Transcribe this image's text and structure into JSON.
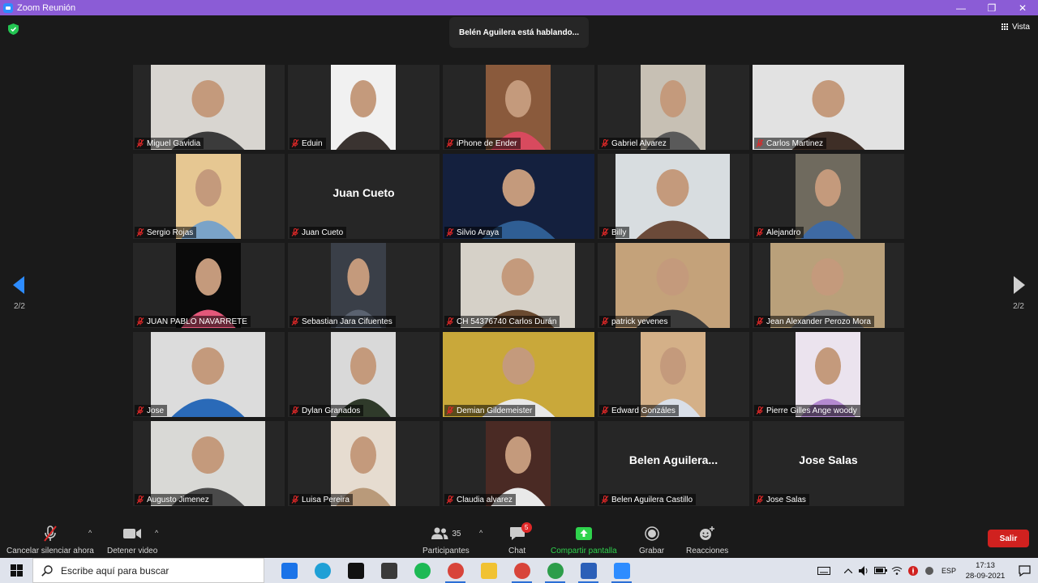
{
  "window": {
    "title": "Zoom Reunión",
    "minimize": "—",
    "maximize": "❐",
    "close": "✕"
  },
  "meeting": {
    "speaking_banner": "Belén Aguilera está hablando...",
    "view_label": "Vista",
    "page_left": "2/2",
    "page_right": "2/2"
  },
  "participants": [
    {
      "name": "Miguel Gavidia",
      "video": {
        "x": 22,
        "w": 141,
        "bg": "#d8d5d0",
        "fg": "#3b3b3b"
      }
    },
    {
      "name": "Eduin",
      "video": {
        "x": 53,
        "w": 80,
        "bg": "#f1f1f1",
        "fg": "#3a3330"
      }
    },
    {
      "name": "iPhone de Ender",
      "video": {
        "x": 53,
        "w": 80,
        "bg": "#8a5a3c",
        "fg": "#d84a5e"
      }
    },
    {
      "name": "Gabriel Alvarez",
      "video": {
        "x": 53,
        "w": 80,
        "bg": "#c7c0b4",
        "fg": "#5a5a5a"
      }
    },
    {
      "name": "Carlos Martinez",
      "video": {
        "x": 0,
        "w": 187,
        "bg": "#e2e2e2",
        "fg": "#3e2e26"
      }
    },
    {
      "name": "Sergio Rojas",
      "video": {
        "x": 53,
        "w": 80,
        "bg": "#e6c792",
        "fg": "#7aa3c8"
      }
    },
    {
      "name": "Juan Cueto",
      "name_display": "Juan Cueto"
    },
    {
      "name": "Silvio Araya",
      "video": {
        "x": 0,
        "w": 187,
        "bg": "#14203e",
        "fg": "#2f5e94"
      }
    },
    {
      "name": "Billy",
      "video": {
        "x": 22,
        "w": 141,
        "bg": "#d8dde0",
        "fg": "#6b4a39"
      }
    },
    {
      "name": "Alejandro",
      "video": {
        "x": 53,
        "w": 80,
        "bg": "#6f6a5e",
        "fg": "#3e6aa4"
      }
    },
    {
      "name": "JUAN PABLO  NAVARRETE",
      "video": {
        "x": 53,
        "w": 80,
        "bg": "#0a0a0a",
        "fg": "#e4587a"
      }
    },
    {
      "name": "Sebastian Jara Cifuentes",
      "video": {
        "x": 53,
        "w": 68,
        "bg": "#3a3f48",
        "fg": "#5a6270"
      }
    },
    {
      "name": "CH 54376740 Carlos Durán",
      "video": {
        "x": 22,
        "w": 141,
        "bg": "#d6d1c8",
        "fg": "#6a4a30"
      }
    },
    {
      "name": "patrick yevenes",
      "video": {
        "x": 22,
        "w": 141,
        "bg": "#c4a27a",
        "fg": "#3a3a3a"
      }
    },
    {
      "name": "Jean Alexander Perozo Mora",
      "video": {
        "x": 22,
        "w": 141,
        "bg": "#b9a07a",
        "fg": "#7a7a7a"
      }
    },
    {
      "name": "Jose",
      "video": {
        "x": 22,
        "w": 141,
        "bg": "#dcdcdc",
        "fg": "#2a6ab8"
      }
    },
    {
      "name": "Dylan Granados",
      "video": {
        "x": 53,
        "w": 80,
        "bg": "#d9d9d9",
        "fg": "#2f3a2a"
      }
    },
    {
      "name": "Demian Gildemeister",
      "video": {
        "x": 0,
        "w": 187,
        "bg": "#c9a83a",
        "fg": "#e8e8e8"
      }
    },
    {
      "name": "Edward Gonzáles",
      "video": {
        "x": 53,
        "w": 80,
        "bg": "#d4b088",
        "fg": "#d9dfe8"
      }
    },
    {
      "name": "Pierre Gilles Ange woody",
      "video": {
        "x": 53,
        "w": 80,
        "bg": "#ebe3ee",
        "fg": "#b48ad0"
      }
    },
    {
      "name": "Augusto Jimenez",
      "video": {
        "x": 22,
        "w": 141,
        "bg": "#d9d9d6",
        "fg": "#4a4a4a"
      }
    },
    {
      "name": "Luisa Pereira",
      "video": {
        "x": 53,
        "w": 80,
        "bg": "#e6dcd0",
        "fg": "#b99a7a"
      }
    },
    {
      "name": "Claudia alvarez",
      "video": {
        "x": 53,
        "w": 80,
        "bg": "#4a2a24",
        "fg": "#e9e9e9"
      }
    },
    {
      "name": "Belen Aguilera Castillo",
      "name_display": "Belen  Aguilera..."
    },
    {
      "name": "Jose Salas",
      "name_display": "Jose Salas"
    }
  ],
  "toolbar": {
    "mute_label": "Cancelar silenciar ahora",
    "video_label": "Detener video",
    "participants_label": "Participantes",
    "participants_count": "35",
    "chat_label": "Chat",
    "chat_badge": "5",
    "share_label": "Compartir pantalla",
    "record_label": "Grabar",
    "reactions_label": "Reacciones",
    "leave_label": "Salir",
    "caret": "^"
  },
  "taskbar": {
    "search_placeholder": "Escribe aquí para buscar",
    "apps": [
      {
        "icon": "mail-icon",
        "color": "#1a73e8"
      },
      {
        "icon": "edge-icon",
        "color": "#1fa0d6"
      },
      {
        "icon": "netflix-icon",
        "color": "#111111"
      },
      {
        "icon": "store-icon",
        "color": "#3a3a3a"
      },
      {
        "icon": "spotify-icon",
        "color": "#1db954"
      },
      {
        "icon": "chrome-icon",
        "color": "#d8443a"
      },
      {
        "icon": "folder-icon",
        "color": "#f1c232"
      },
      {
        "icon": "chrome-icon-2",
        "color": "#d8443a"
      },
      {
        "icon": "chrome-icon-3",
        "color": "#2d9d4a"
      },
      {
        "icon": "word-icon",
        "color": "#2b5fb8"
      },
      {
        "icon": "zoom-icon",
        "color": "#2d8cff"
      }
    ],
    "language": "ESP",
    "time": "17:13",
    "date": "28-09-2021"
  },
  "colors": {
    "titlebar": "#8b5cd6",
    "background": "#1a1a1a",
    "tile": "#262626",
    "mute": "#e02828",
    "share": "#2fd34d",
    "leave": "#d0211f",
    "nav_arrow": "#2d8cff"
  }
}
